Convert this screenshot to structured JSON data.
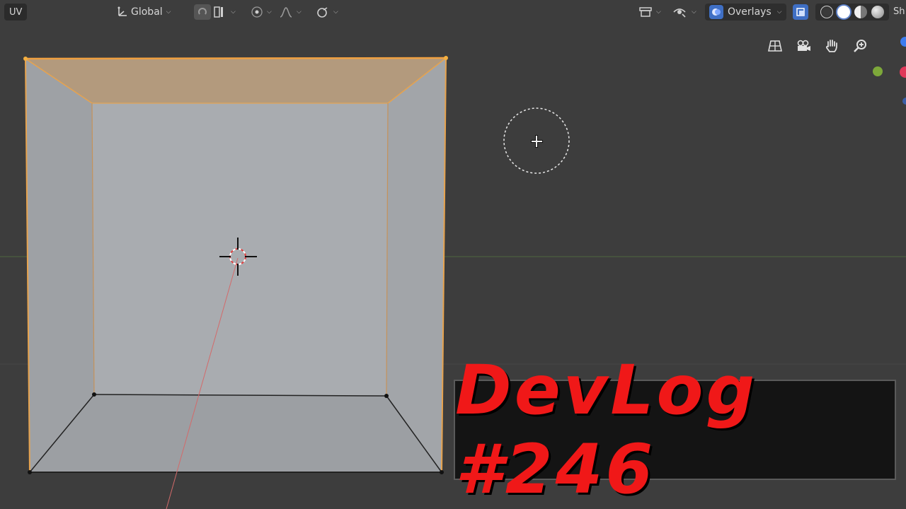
{
  "header": {
    "uv_label": "UV",
    "transform_orientation": "Global",
    "overlays_label": "Overlays",
    "shading_label_partial": "Sh"
  },
  "icons": {
    "transform_orientation": "axes-icon",
    "snap": "snap-icon",
    "proportional": "proportional-edit-icon",
    "falloff": "falloff-curve-icon",
    "link": "link-icon",
    "view_object_types": "view-types-icon",
    "gizmos": "gizmo-icon",
    "overlays": "overlays-icon",
    "xray": "xray-icon",
    "nav": [
      "grid-view-icon",
      "camera-icon",
      "hand-pan-icon",
      "zoom-icon"
    ]
  },
  "shading_modes": [
    "wireframe",
    "solid",
    "material-preview",
    "rendered"
  ],
  "active_shading": "solid",
  "banner": {
    "text": "DevLog #246"
  },
  "colors": {
    "background": "#3d3d3d",
    "selection_orange": "#f0a040",
    "mesh_face": "#a4a7ab",
    "banner_text": "#f01818",
    "accent_blue": "#3f6fc4"
  }
}
